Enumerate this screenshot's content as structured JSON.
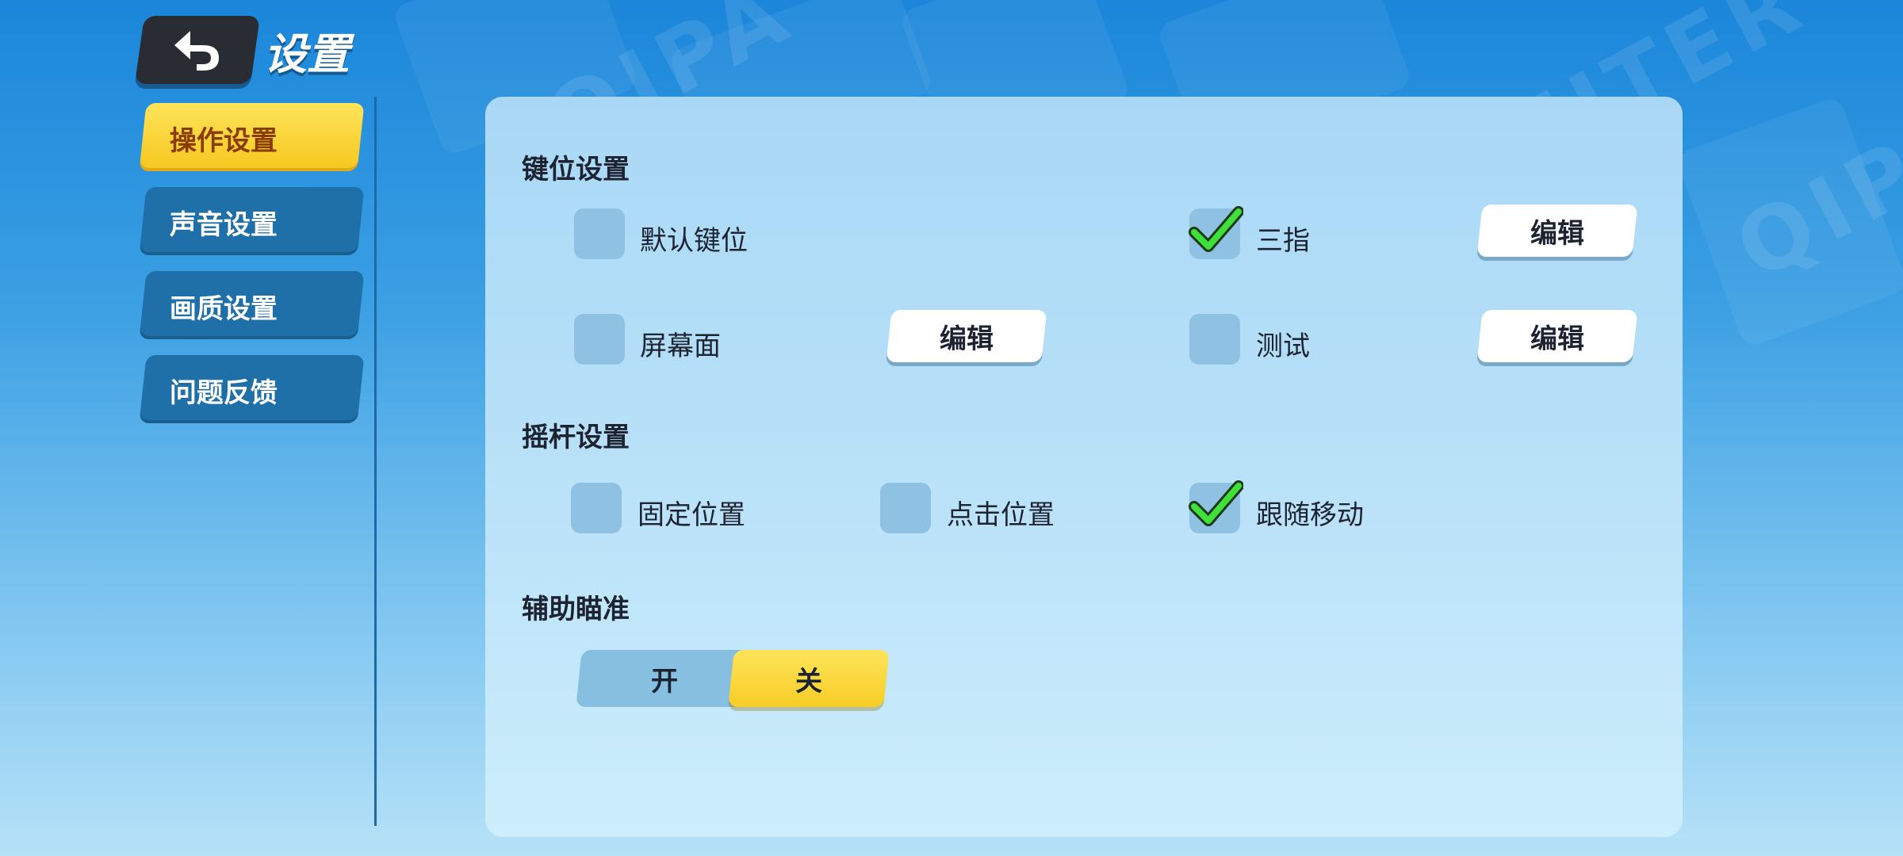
{
  "header": {
    "title": "设置",
    "back_icon": "back-arrow-icon"
  },
  "sidebar": {
    "items": [
      {
        "label": "操作设置",
        "active": true
      },
      {
        "label": "声音设置",
        "active": false
      },
      {
        "label": "画质设置",
        "active": false
      },
      {
        "label": "问题反馈",
        "active": false
      }
    ]
  },
  "keybind": {
    "title": "键位设置",
    "options": [
      {
        "label": "默认键位",
        "checked": false
      },
      {
        "label": "三指",
        "checked": true
      },
      {
        "label": "屏幕面",
        "checked": false
      },
      {
        "label": "测试",
        "checked": false
      }
    ],
    "edit_label": "编辑"
  },
  "joystick": {
    "title": "摇杆设置",
    "options": [
      {
        "label": "固定位置",
        "checked": false
      },
      {
        "label": "点击位置",
        "checked": false
      },
      {
        "label": "跟随移动",
        "checked": true
      }
    ]
  },
  "aim_assist": {
    "title": "辅助瞄准",
    "on_label": "开",
    "off_label": "关",
    "selected": "关"
  },
  "colors": {
    "accent_yellow": "#f6c61e",
    "check_green": "#3fe03a",
    "nav_blue": "#1f6fa8"
  }
}
